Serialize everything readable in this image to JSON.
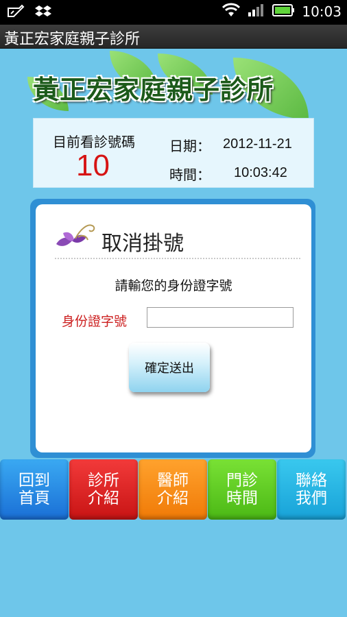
{
  "status_bar": {
    "time": "10:03",
    "icons": [
      "notification-icon",
      "dropbox-icon",
      "wifi-icon",
      "signal-icon",
      "battery-icon"
    ]
  },
  "app": {
    "title": "黃正宏家庭親子診所",
    "logo_text": "黃正宏家庭親子診所"
  },
  "info": {
    "current_label": "目前看診號碼",
    "current_number": "10",
    "date_label": "日期：",
    "date_value": "2012-11-21",
    "time_label": "時間：",
    "time_value": "10:03:42"
  },
  "cancel_form": {
    "heading": "取消掛號",
    "prompt": "請輸您的身份證字號",
    "id_label": "身份證字號",
    "id_value": "",
    "submit_label": "確定送出"
  },
  "nav": {
    "items": [
      {
        "label": "回到\n首頁",
        "color": "#1a6fd6"
      },
      {
        "label": "診所\n介紹",
        "color": "#c81414"
      },
      {
        "label": "醫師\n介紹",
        "color": "#f07a07"
      },
      {
        "label": "門診\n時間",
        "color": "#4bb815"
      },
      {
        "label": "聯絡\n我們",
        "color": "#18a2d8"
      }
    ]
  },
  "colors": {
    "background": "#6ec6ea",
    "number_red": "#d61414",
    "frame_blue": "#2f8fd4"
  }
}
